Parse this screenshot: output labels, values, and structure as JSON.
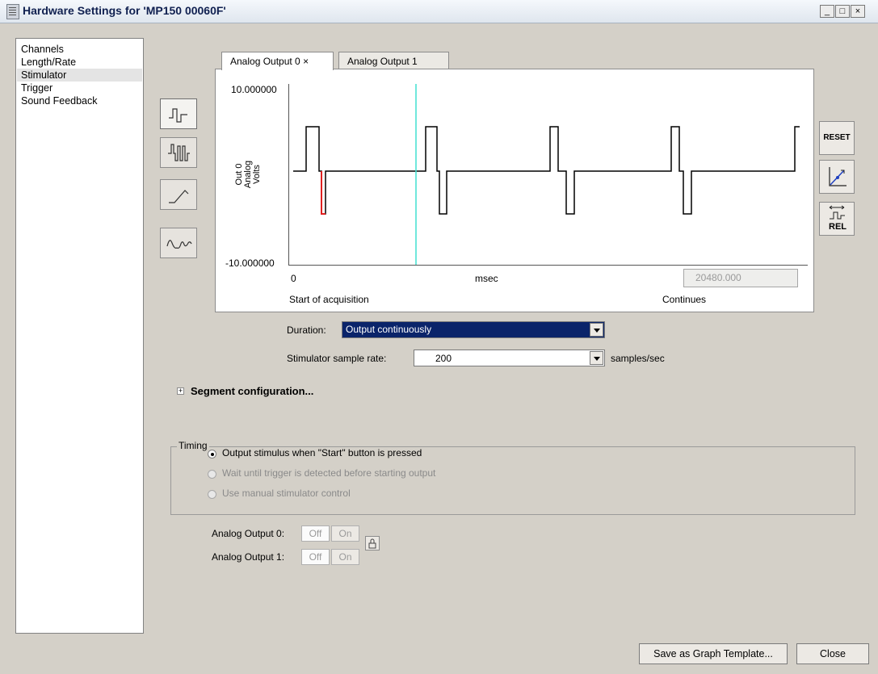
{
  "window": {
    "title": "Hardware Settings for 'MP150 00060F'",
    "minimize": "_",
    "maximize": "□",
    "close": "×"
  },
  "nav": {
    "items": [
      {
        "label": "Channels"
      },
      {
        "label": "Length/Rate"
      },
      {
        "label": "Stimulator"
      },
      {
        "label": "Trigger"
      },
      {
        "label": "Sound Feedback"
      }
    ],
    "selected": "Stimulator"
  },
  "waveform_buttons": [
    {
      "icon": "pulse-wave-icon"
    },
    {
      "icon": "pulse-train-icon"
    },
    {
      "icon": "ramp-wave-icon"
    },
    {
      "icon": "sine-wave-icon"
    }
  ],
  "tabs": [
    {
      "label": "Analog Output 0 ×",
      "active": true
    },
    {
      "label": "Analog Output 1",
      "active": false
    }
  ],
  "plot": {
    "y_max": "10.000000",
    "y_min": "-10.000000",
    "y_label_line1": "Out 0",
    "y_label_line2": "Analog",
    "y_label_line3": "Volts",
    "x_start": "0",
    "x_unit": "msec",
    "x_end_value": "20480.000",
    "start_caption": "Start of acquisition",
    "end_caption": "Continues",
    "colors": {
      "trace": "#000000",
      "highlight": "#e02020",
      "cursor": "#40e0d0"
    }
  },
  "side_buttons": {
    "reset_label": "RESET",
    "autoscale_icon": "autoscale-icon",
    "rel_label": "REL",
    "rel_icon": "relative-timing-icon"
  },
  "duration": {
    "label": "Duration:",
    "value": "Output continuously",
    "accent": "#0a246a"
  },
  "sample_rate": {
    "label": "Stimulator sample rate:",
    "value": "200",
    "unit": "samples/sec"
  },
  "segment": {
    "expander": "+",
    "label": "Segment configuration..."
  },
  "timing": {
    "legend": "Timing",
    "options": [
      {
        "label": "Output stimulus when \"Start\" button is pressed",
        "selected": true,
        "enabled": true
      },
      {
        "label": "Wait until trigger is detected before starting output",
        "selected": false,
        "enabled": false
      },
      {
        "label": "Use manual stimulator control",
        "selected": false,
        "enabled": false
      }
    ]
  },
  "analog_outputs": [
    {
      "label": "Analog Output 0:",
      "off": "Off",
      "on": "On"
    },
    {
      "label": "Analog Output 1:",
      "off": "Off",
      "on": "On"
    }
  ],
  "lock_icon": "lock-icon",
  "buttons": {
    "save_template": "Save as Graph Template...",
    "close": "Close"
  }
}
